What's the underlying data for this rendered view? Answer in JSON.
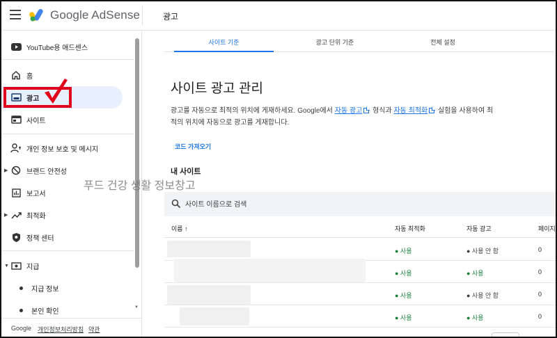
{
  "app": {
    "brand": "Google AdSense",
    "page_header": "광고"
  },
  "sidebar": {
    "items": [
      {
        "label": "YouTube용 애드센스",
        "icon": "youtube-icon"
      },
      {
        "label": "홈",
        "icon": "home-icon"
      },
      {
        "label": "광고",
        "icon": "ads-icon",
        "active": true
      },
      {
        "label": "사이트",
        "icon": "sites-icon"
      },
      {
        "label": "개인 정보 보호 및 메시지",
        "icon": "privacy-icon"
      },
      {
        "label": "브랜드 안전성",
        "icon": "block-icon",
        "expandable": true
      },
      {
        "label": "보고서",
        "icon": "reports-icon"
      },
      {
        "label": "최적화",
        "icon": "optimize-icon",
        "expandable": true
      },
      {
        "label": "정책 센터",
        "icon": "policy-icon"
      },
      {
        "label": "지급",
        "icon": "payments-icon",
        "expanded": true
      },
      {
        "label": "지급 정보",
        "sub": true
      },
      {
        "label": "본인 확인",
        "sub": true
      }
    ],
    "footer": {
      "google": "Google",
      "privacy": "개인정보처리방침",
      "terms": "약관"
    }
  },
  "tabs": [
    {
      "label": "사이트 기준",
      "active": true
    },
    {
      "label": "광고 단위 기준",
      "active": false
    },
    {
      "label": "전체 설정",
      "active": false
    }
  ],
  "main": {
    "title": "사이트 광고 관리",
    "desc_part1": "광고를 자동으로 최적의 위치에 게재하세요. Google에서 ",
    "desc_link1": "자동 광고",
    "desc_part2": " 형식과 ",
    "desc_link2": "자동 최적화",
    "desc_part3": " 실험을 사용하여 최적의 위치에 자동으로 광고를 게재합니다.",
    "code_link": "코드 가져오기",
    "section_title": "내 사이트",
    "search_placeholder": "사이트 이름으로 검색"
  },
  "watermark": "푸드 건강 생활 정보창고",
  "table": {
    "columns": [
      "이름 ↑",
      "자동 최적화",
      "자동 광고",
      "페이지"
    ],
    "rows": [
      {
        "auto_opt": "● 사용",
        "auto_ads": "● 사용 안 함",
        "pages": "0"
      },
      {
        "auto_opt": "● 사용",
        "auto_ads": "● 사용",
        "pages": "0"
      },
      {
        "auto_opt": "● 사용",
        "auto_ads": "● 사용 안 함",
        "pages": "0"
      },
      {
        "auto_opt": "● 사용",
        "auto_ads": "● 사용",
        "pages": "0"
      }
    ]
  },
  "colors": {
    "accent": "#1a73e8",
    "active_nav": "#e8f0fe",
    "status_green": "#188038",
    "highlight_red": "#e3001b"
  }
}
